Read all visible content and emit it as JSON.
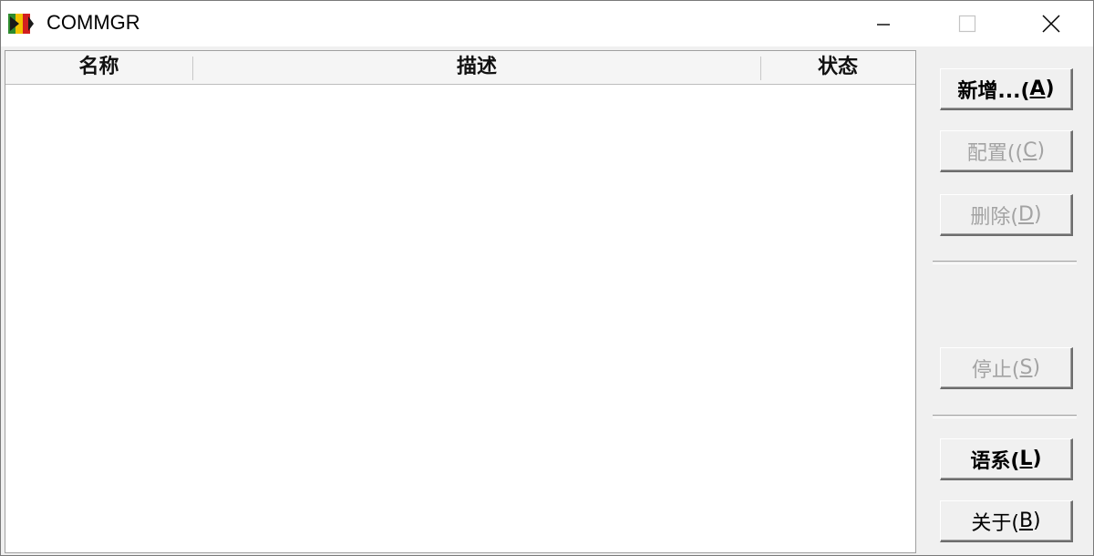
{
  "window": {
    "title": "COMMGR",
    "icon": "app-flag-icon",
    "controls": [
      "minimize-icon",
      "maximize-icon",
      "close-icon"
    ]
  },
  "listview": {
    "columns": [
      "名称",
      "描述",
      "状态"
    ],
    "rows": []
  },
  "buttons": {
    "add": {
      "label": "新增...(",
      "key": "A",
      "end": ")"
    },
    "config": {
      "label": "配置((",
      "key": "C",
      "end": ")"
    },
    "delete": {
      "label": "删除(",
      "key": "D",
      "end": ")"
    },
    "stop": {
      "label": "停止(",
      "key": "S",
      "end": ")"
    },
    "language": {
      "label": "语系(",
      "key": "L",
      "end": ")"
    },
    "about": {
      "label": "关于(",
      "key": "B",
      "end": ")"
    }
  },
  "colors": {
    "disabled_text": "#a3a3a3",
    "window_bg": "#f0f0f0",
    "list_bg": "#ffffff"
  }
}
